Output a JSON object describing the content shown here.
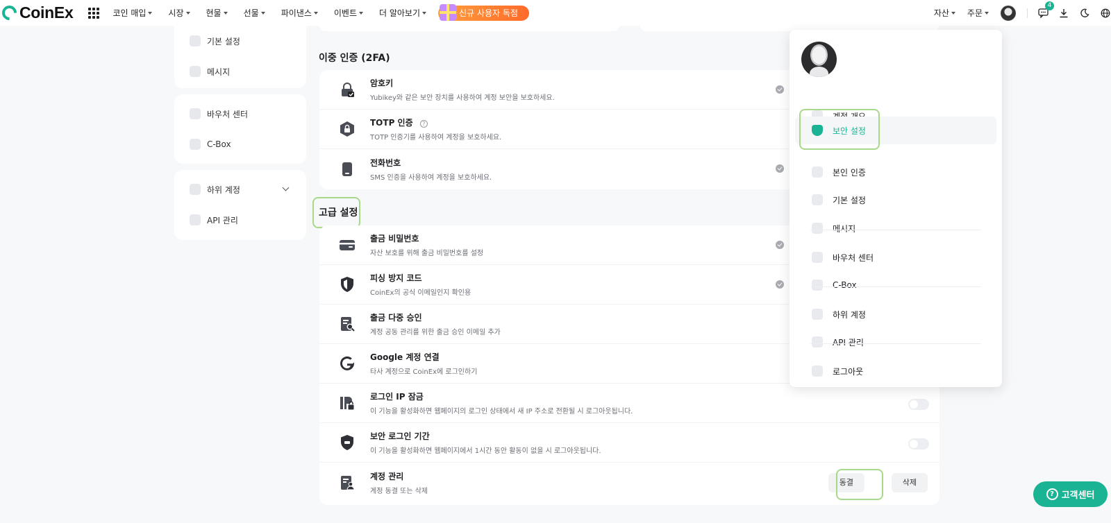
{
  "nav": {
    "logo_text": "CoinEx",
    "menu": [
      "코인 매입",
      "시장",
      "현물",
      "선물",
      "파이낸스",
      "이벤트",
      "더 알아보기"
    ],
    "promo": "신규 사용자 독점",
    "right_menu": [
      "자산",
      "주문"
    ],
    "message_count": "4"
  },
  "sidebar": {
    "group1": [
      "기본 설정",
      "메시지"
    ],
    "group2": [
      "바우처 센터",
      "C-Box"
    ],
    "group3": [
      "하위 계정",
      "API 관리"
    ]
  },
  "twofa": {
    "title": "이중 인증 (2FA)",
    "rows": [
      {
        "title": "암호키",
        "desc": "Yubikey와 같은 보안 장치를 사용하여 계정 보안을 보호하세요."
      },
      {
        "title": "TOTP 인증",
        "desc": "TOTP 인증기를 사용하여 계정을 보호하세요."
      },
      {
        "title": "전화번호",
        "desc": "SMS 인증을 사용하여 계정을 보호하세요."
      }
    ]
  },
  "advanced": {
    "title": "고급 설정",
    "rows": [
      {
        "title": "출금 비밀번호",
        "desc": "자산 보호를 위해 출금 비밀번호를 설정"
      },
      {
        "title": "피싱 방지 코드",
        "desc": "CoinEx의 공식 이메일인지 확인용"
      },
      {
        "title": "출금 다중 승인",
        "desc": "계정 공동 관리를 위한 출금 승인 이메일 추가"
      },
      {
        "title": "Google 계정 연결",
        "desc": "타사 계정으로 CoinEx에 로그인하기"
      },
      {
        "title": "로그인 IP 잠금",
        "desc": "이 기능을 활성화하면 웹페이지의 로그인 상태에서 새 IP 주소로 전환될 시 로그아웃됩니다."
      },
      {
        "title": "보안 로그인 기간",
        "desc": "이 기능을 활성화하면 웹페이지에서 1시간 동안 활동이 없을 시 로그아웃됩니다."
      },
      {
        "title": "계정 관리",
        "desc": "계정 동결 또는 삭제"
      }
    ],
    "freeze_label": "동결",
    "delete_label": "삭제"
  },
  "dropdown": {
    "items": [
      "계정 개요",
      "보안 설정",
      "본인 인증",
      "기본 설정",
      "메시지",
      "바우처 센터",
      "C-Box",
      "하위 계정",
      "API 관리",
      "로그아웃"
    ],
    "active": "보안 설정"
  },
  "help": {
    "label": "고객센터",
    "icon": "?"
  },
  "colors": {
    "accent": "#1ab394",
    "highlight": "#a8d98a",
    "promo": "#ff7a30"
  }
}
